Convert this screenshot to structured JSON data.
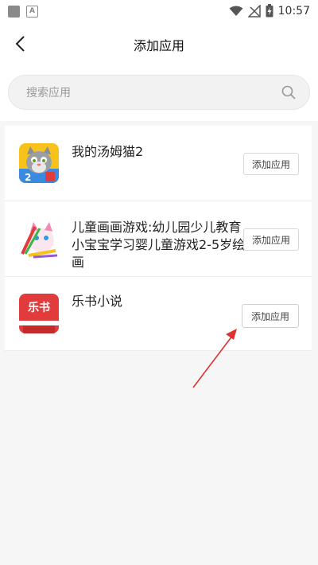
{
  "status_bar": {
    "time": "10:57",
    "icons": [
      "notification-square-icon",
      "a-notification-icon",
      "wifi-icon",
      "no-signal-icon",
      "battery-charging-icon"
    ]
  },
  "header": {
    "title": "添加应用",
    "back_icon": "back-arrow-icon"
  },
  "search": {
    "placeholder": "搜索应用",
    "icon": "search-icon"
  },
  "apps": [
    {
      "name": "我的汤姆猫2",
      "button": "添加应用",
      "icon": "talking-tom-icon"
    },
    {
      "name": "儿童画画游戏:幼儿园少儿教育小宝宝学习婴儿童游戏2-5岁绘画",
      "button": "添加应用",
      "icon": "kids-drawing-icon"
    },
    {
      "name": "乐书小说",
      "button": "添加应用",
      "icon": "leshu-novel-icon",
      "icon_text": "乐书"
    }
  ],
  "colors": {
    "background": "#f6f6f6",
    "annotation_arrow": "#e03030",
    "leshu_red": "#e23b3b"
  }
}
